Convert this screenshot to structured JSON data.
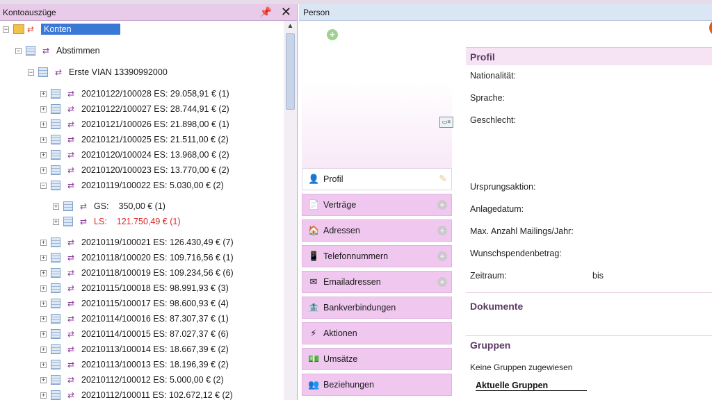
{
  "left_panel": {
    "title": "Kontoauszüge",
    "pin_icon": "📌",
    "close_icon": "✕",
    "tree": {
      "root_label": "Konten",
      "level1_label": "Abstimmen",
      "level2_label": "Erste VIAN 13390992000",
      "entries": [
        "20210122/100028 ES: 29.058,91 € (1)",
        "20210122/100027 ES: 28.744,91 € (2)",
        "20210121/100026 ES: 21.898,00 € (1)",
        "20210121/100025 ES: 21.511,00 € (2)",
        "20210120/100024 ES: 13.968,00 € (2)",
        "20210120/100023 ES: 13.770,00 € (2)",
        "20210119/100022 ES: 5.030,00 € (2)"
      ],
      "sub_entries": [
        {
          "label": "GS:",
          "value": "350,00 € (1)",
          "red": false
        },
        {
          "label": "LS:",
          "value": "121.750,49 € (1)",
          "red": true
        }
      ],
      "entries_after": [
        "20210119/100021 ES: 126.430,49 € (7)",
        "20210118/100020 ES: 109.716,56 € (1)",
        "20210118/100019 ES: 109.234,56 € (6)",
        "20210115/100018 ES: 98.991,93 € (3)",
        "20210115/100017 ES: 98.600,93 € (4)",
        "20210114/100016 ES: 87.307,37 € (1)",
        "20210114/100015 ES: 87.027,37 € (6)",
        "20210113/100014 ES: 18.667,39 € (2)",
        "20210113/100013 ES: 18.196,39 € (2)",
        "20210112/100012 ES: 5.000,00 € (2)",
        "20210112/100011 ES: 102.672,12 € (2)"
      ]
    }
  },
  "right_panel": {
    "title": "Person",
    "nav": [
      {
        "label": "Profil",
        "icon": "person-icon",
        "active": true
      },
      {
        "label": "Verträge",
        "icon": "document-icon"
      },
      {
        "label": "Adressen",
        "icon": "house-icon"
      },
      {
        "label": "Telefonnummern",
        "icon": "phone-icon"
      },
      {
        "label": "Emailadressen",
        "icon": "envelope-icon"
      },
      {
        "label": "Bankverbindungen",
        "icon": "bank-icon"
      },
      {
        "label": "Aktionen",
        "icon": "lightning-icon"
      },
      {
        "label": "Umsätze",
        "icon": "money-icon"
      },
      {
        "label": "Beziehungen",
        "icon": "people-icon"
      }
    ],
    "profile": {
      "heading": "Profil",
      "fields_top": [
        "Nationalität:",
        "Sprache:",
        "Geschlecht:"
      ],
      "fields_bottom": [
        "Ursprungsaktion:",
        "Anlagedatum:",
        "Max. Anzahl Mailings/Jahr:",
        "Wunschspendenbetrag:",
        "Zeitraum:"
      ],
      "zeitraum_bis": "bis"
    },
    "documents": {
      "heading": "Dokumente"
    },
    "groups": {
      "heading": "Gruppen",
      "empty_text": "Keine Gruppen zugewiesen",
      "current_label": "Aktuelle Gruppen"
    },
    "colors": {
      "nav_bg": "#f0c8ef",
      "heading": "#5b3a66",
      "selection": "#3a78d6",
      "red": "#e02424"
    }
  }
}
